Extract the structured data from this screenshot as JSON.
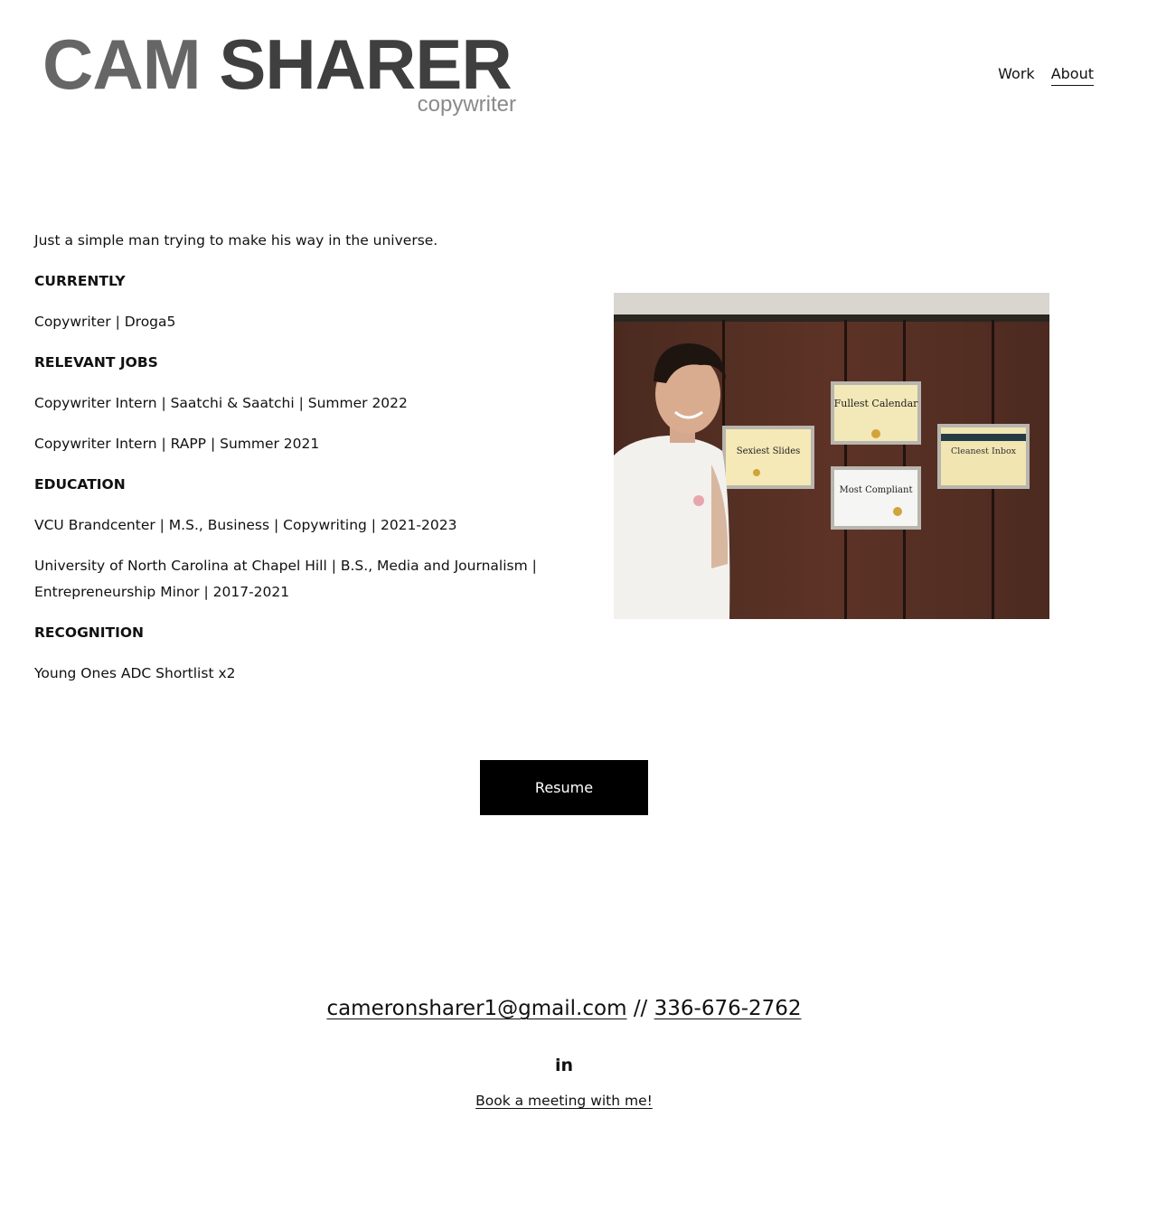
{
  "header": {
    "logo_first": "CAM",
    "logo_last": "SHARER",
    "logo_tagline": "copywriter",
    "nav": [
      {
        "label": "Work",
        "active": false
      },
      {
        "label": "About",
        "active": true
      }
    ]
  },
  "about": {
    "intro": "Just a simple man trying to make his way in the universe.",
    "currently_heading": "CURRENTLY",
    "currently_text": "Copywriter | Droga5",
    "jobs_heading": "RELEVANT JOBS",
    "jobs": [
      "Copywriter Intern | Saatchi & Saatchi | Summer 2022",
      "Copywriter Intern | RAPP | Summer 2021"
    ],
    "education_heading": "EDUCATION",
    "education": [
      "VCU Brandcenter |  M.S., Business | Copywriting | 2021-2023",
      "University of North Carolina at Chapel Hill | B.S., Media and Journalism  |  Entrepreneurship Minor | 2017-2021"
    ],
    "recognition_heading": "RECOGNITION",
    "recognition_text": "Young Ones ADC Shortlist x2"
  },
  "photo": {
    "certificates": [
      "Fullest Calendar",
      "Sexiest Slides",
      "Cleanest Inbox",
      "Most Compliant"
    ]
  },
  "resume_button_label": "Resume",
  "footer": {
    "email": "cameronsharer1@gmail.com",
    "separator": "//",
    "phone": "336-676-2762",
    "linkedin_icon": "linkedin-icon",
    "linkedin_glyph": "in",
    "meeting_link": "Book a meeting with me!"
  }
}
